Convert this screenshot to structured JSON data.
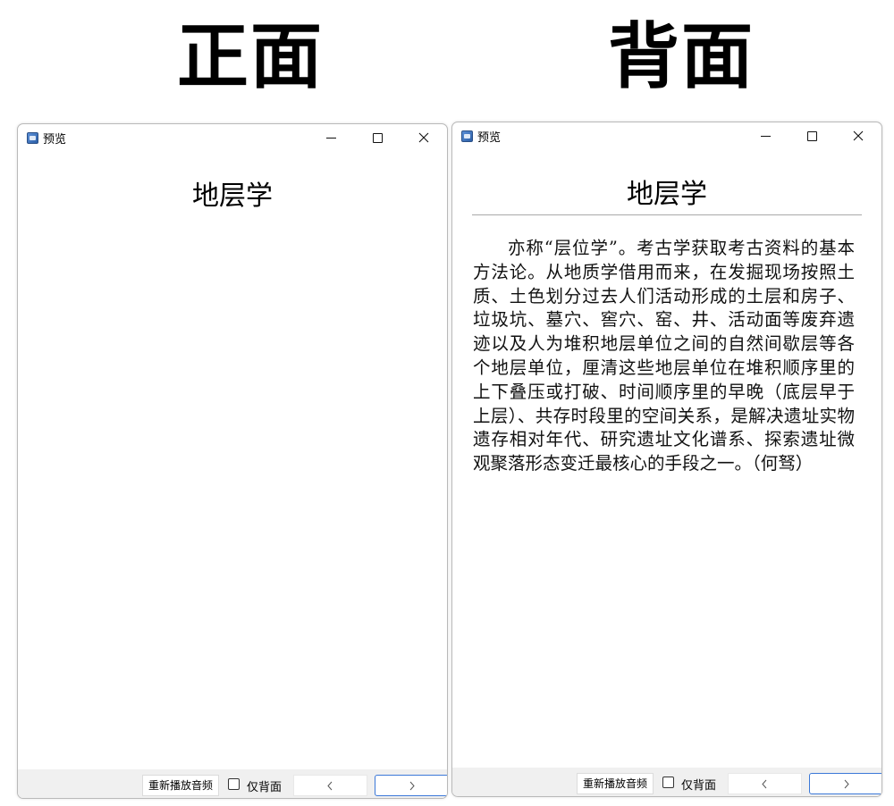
{
  "headings": {
    "front": "正面",
    "back": "背面"
  },
  "windows": [
    {
      "id": "front",
      "title": "预览",
      "card_title": "地层学",
      "replay_label": "重新播放音频",
      "back_only_label": "仅背面",
      "back_only_checked": false
    },
    {
      "id": "back",
      "title": "预览",
      "card_title": "地层学",
      "card_text": "亦称“层位学”。考古学获取考古资料的基本方法论。从地质学借用而来，在发掘现场按照土质、土色划分过去人们活动形成的土层和房子、垃圾坑、墓穴、窖穴、窑、井、活动面等废弃遗迹以及人为堆积地层单位之间的自然间歇层等各个地层单位，厘清这些地层单位在堆积顺序里的上下叠压或打破、时间顺序里的早晚（底层早于上层）、共存时段里的空间关系，是解决遗址实物遗存相对年代、研究遗址文化谱系、探索遗址微观聚落形态变迁最核心的手段之一。（何驽）",
      "replay_label": "重新播放音频",
      "back_only_label": "仅背面",
      "back_only_checked": false
    }
  ],
  "icons": {
    "app": "preview-app-icon",
    "minimize": "minimize-icon",
    "maximize": "maximize-icon",
    "close": "close-icon",
    "prev": "chevron-left-icon",
    "next": "chevron-right-icon"
  },
  "colors": {
    "accent": "#3b78d8",
    "bar": "#f0f0f0",
    "divider": "#a9a9a9"
  }
}
